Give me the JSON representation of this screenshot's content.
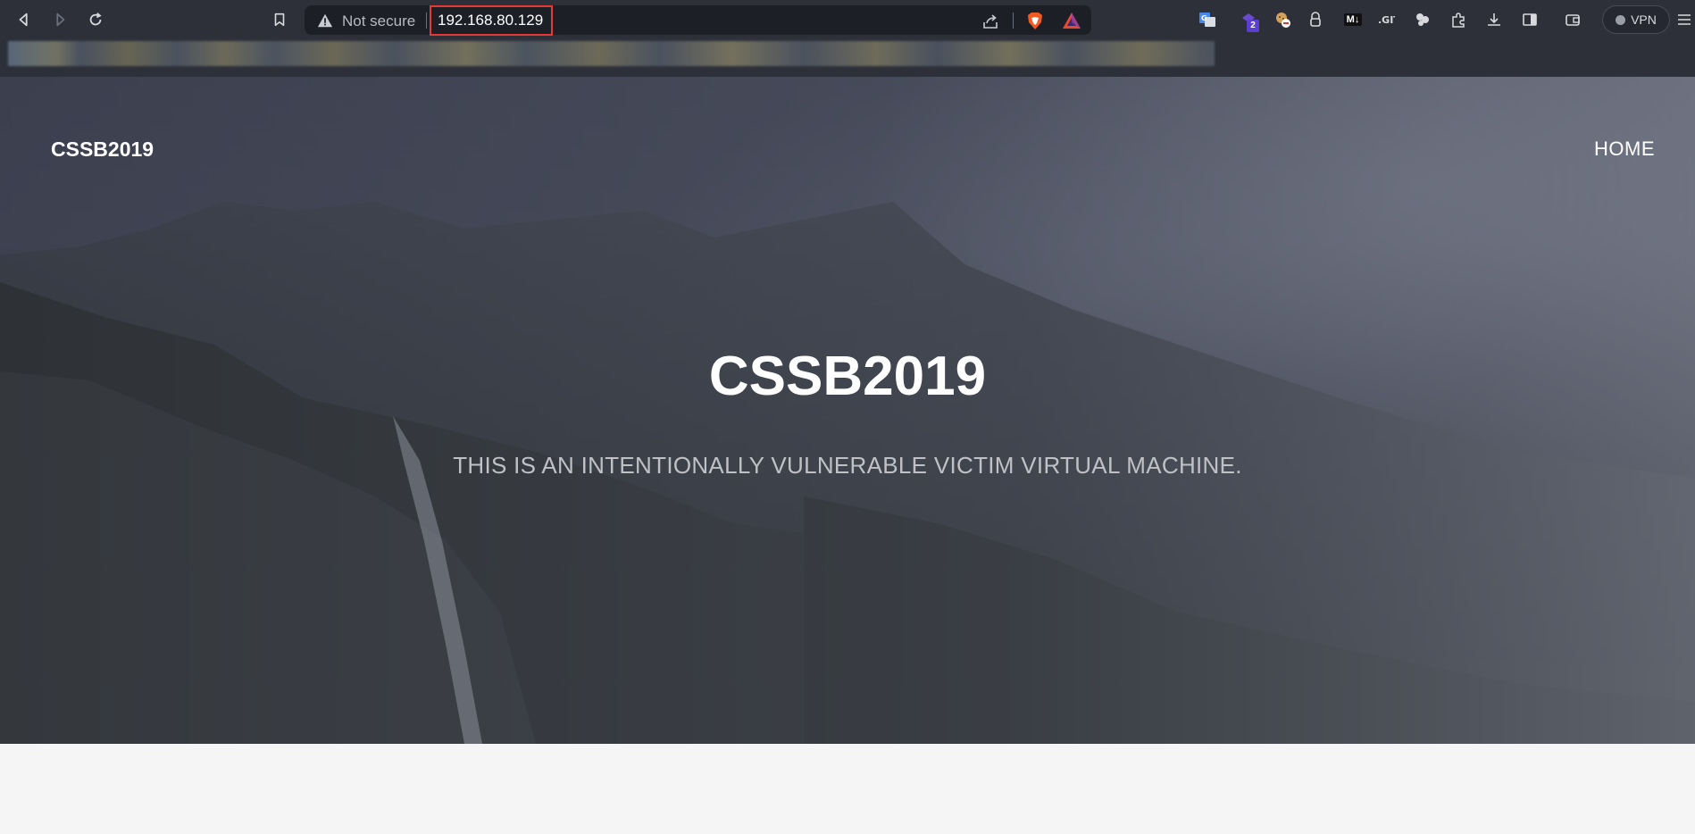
{
  "browser": {
    "address_bar": {
      "security_label": "Not secure",
      "url": "192.168.80.129"
    },
    "extensions": {
      "notification_badge": "2",
      "markdown_label": "M↓",
      "vpn_label": "VPN"
    }
  },
  "page": {
    "brand": "CSSB2019",
    "nav": {
      "home": "HOME"
    },
    "hero": {
      "title": "CSSB2019",
      "subtitle": "THIS IS AN INTENTIONALLY VULNERABLE VICTIM VIRTUAL MACHINE."
    }
  },
  "colors": {
    "chrome_bg": "#2d3039",
    "omnibox_bg": "#1c1f26",
    "url_highlight": "#e53935",
    "hero_text": "#ffffff",
    "subtitle_text": "#bfc1c6",
    "page_bg": "#f5f5f5"
  }
}
